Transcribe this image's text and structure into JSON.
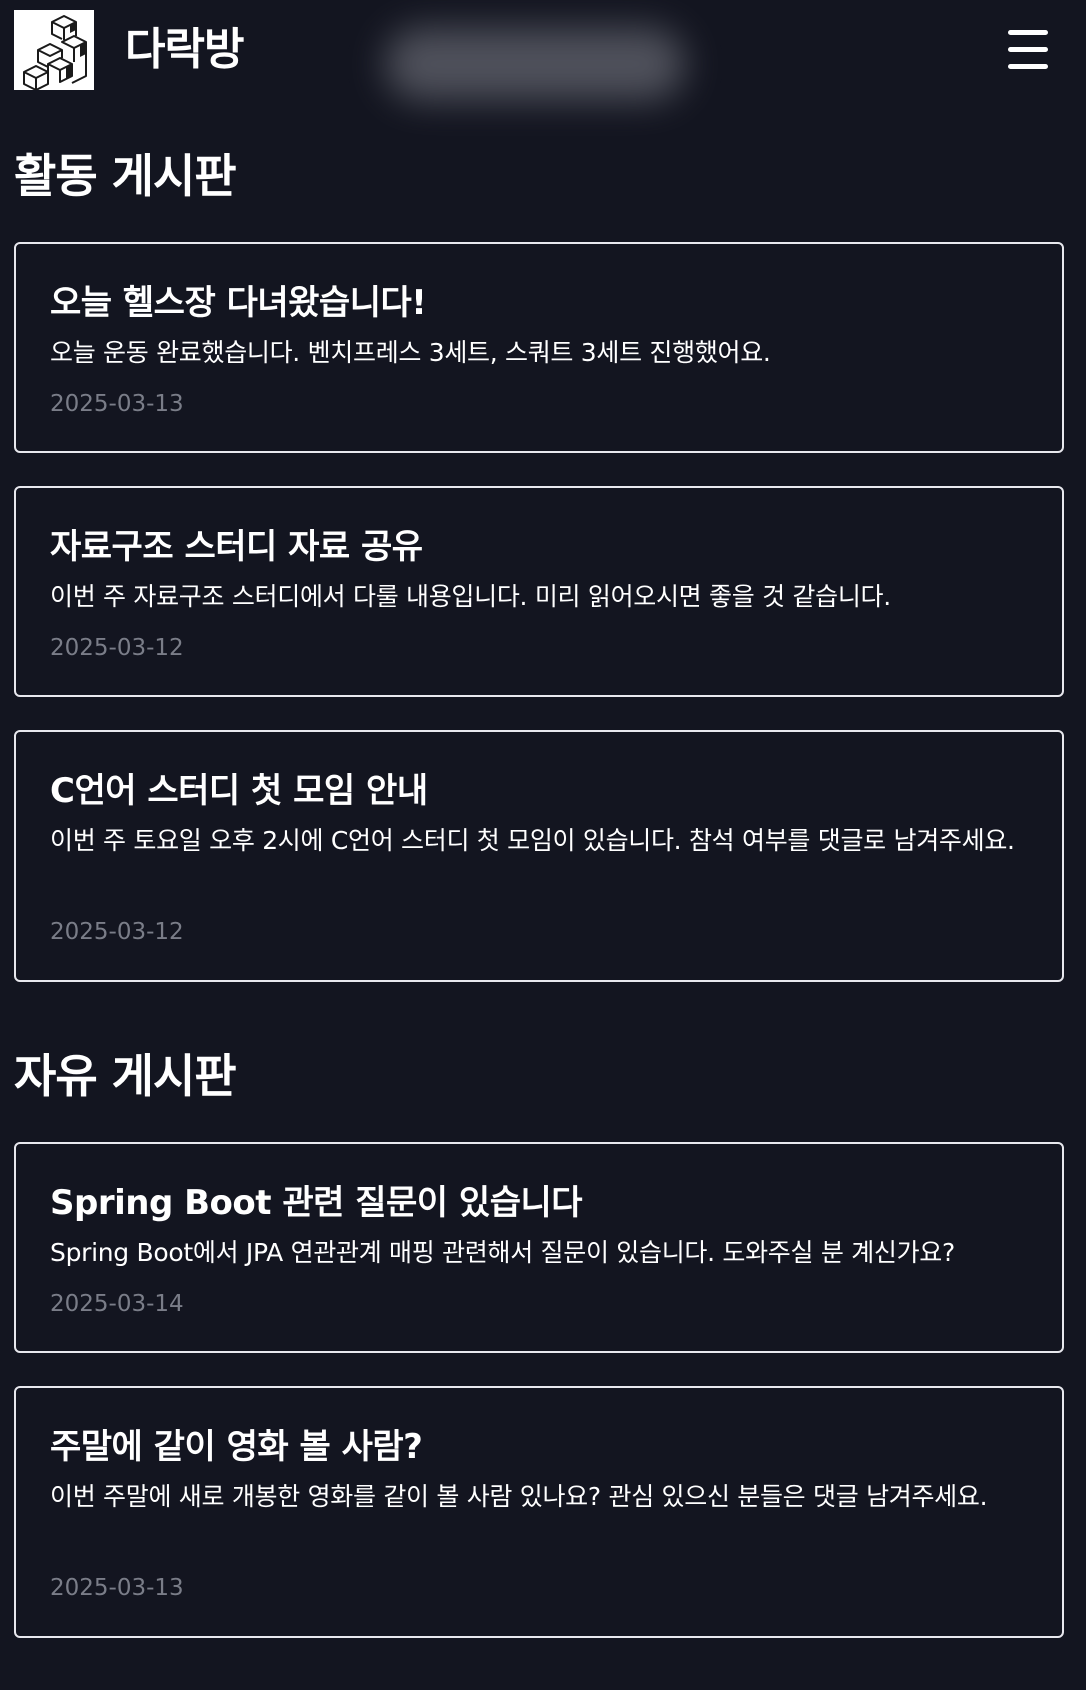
{
  "header": {
    "title": "다락방",
    "logo": "stacked-cubes-logo",
    "menu_icon": "hamburger-menu-icon"
  },
  "sections": [
    {
      "title": "활동 게시판",
      "posts": [
        {
          "title": "오늘 헬스장 다녀왔습니다!",
          "body": "오늘 운동 완료했습니다. 벤치프레스 3세트, 스쿼트 3세트 진행했어요.",
          "date": "2025-03-13"
        },
        {
          "title": "자료구조 스터디 자료 공유",
          "body": "이번 주 자료구조 스터디에서 다룰 내용입니다. 미리 읽어오시면 좋을 것 같습니다.",
          "date": "2025-03-12"
        },
        {
          "title": "C언어 스터디 첫 모임 안내",
          "body": "이번 주 토요일 오후 2시에 C언어 스터디 첫 모임이 있습니다. 참석 여부를 댓글로 남겨주세요.",
          "date": "2025-03-12"
        }
      ]
    },
    {
      "title": "자유 게시판",
      "posts": [
        {
          "title": "Spring Boot 관련 질문이 있습니다",
          "body": "Spring Boot에서 JPA 연관관계 매핑 관련해서 질문이 있습니다. 도와주실 분 계신가요?",
          "date": "2025-03-14"
        },
        {
          "title": "주말에 같이 영화 볼 사람?",
          "body": "이번 주말에 새로 개봉한 영화를 같이 볼 사람 있나요? 관심 있으신 분들은 댓글 남겨주세요.",
          "date": "2025-03-13"
        }
      ]
    }
  ],
  "colors": {
    "background": "#131520",
    "text": "#ffffff",
    "card_border": "#e8e8ee",
    "date_text": "#7a7d88"
  }
}
